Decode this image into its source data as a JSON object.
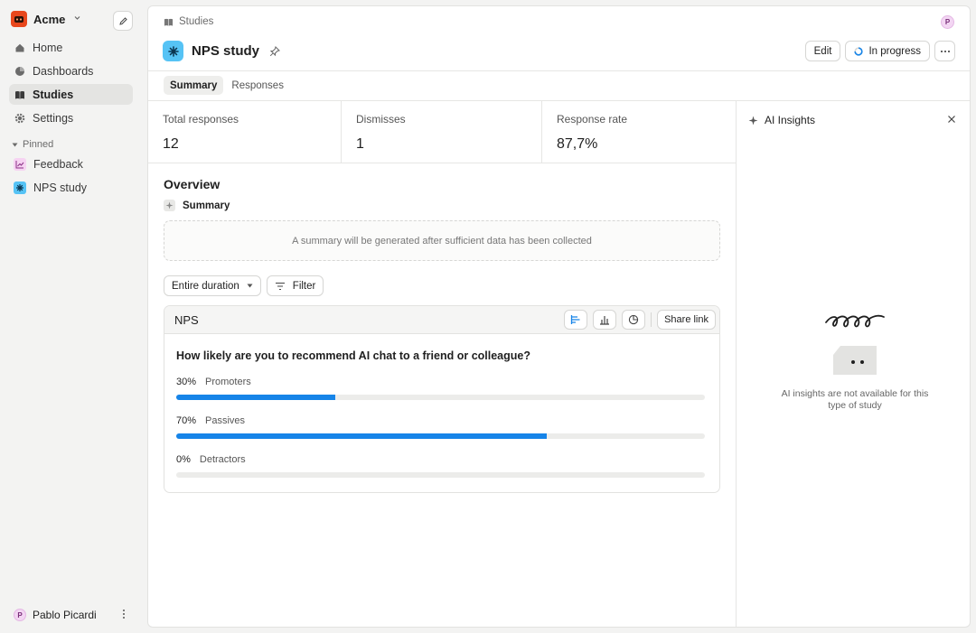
{
  "workspace": {
    "name": "Acme"
  },
  "nav": {
    "items": [
      {
        "label": "Home",
        "icon": "home-icon"
      },
      {
        "label": "Dashboards",
        "icon": "pie-chart-icon"
      },
      {
        "label": "Studies",
        "icon": "book-icon",
        "active": true
      },
      {
        "label": "Settings",
        "icon": "gear-icon"
      }
    ],
    "pinned_label": "Pinned",
    "pinned": [
      {
        "label": "Feedback",
        "icon": "chart-line-icon",
        "color": "#f3c6f0"
      },
      {
        "label": "NPS study",
        "icon": "asterisk-icon",
        "color": "#56c3f5"
      }
    ]
  },
  "user": {
    "name": "Pablo Picardi",
    "initial": "P"
  },
  "header": {
    "breadcrumb": "Studies",
    "title": "NPS study",
    "edit_label": "Edit",
    "status_label": "In progress"
  },
  "tabs": [
    {
      "label": "Summary",
      "active": true
    },
    {
      "label": "Responses",
      "active": false
    }
  ],
  "stats": [
    {
      "label": "Total responses",
      "value": "12"
    },
    {
      "label": "Dismisses",
      "value": "1"
    },
    {
      "label": "Response rate",
      "value": "87,7%"
    }
  ],
  "overview": {
    "title": "Overview",
    "summary_label": "Summary",
    "summary_placeholder": "A summary will be generated after sufficient data has been collected"
  },
  "filters": {
    "duration_label": "Entire duration",
    "filter_label": "Filter"
  },
  "nps_card": {
    "title": "NPS",
    "share_label": "Share link",
    "question": "How likely are you to recommend AI chat to a friend or colleague?",
    "rows": [
      {
        "pct_label": "30%",
        "label": "Promoters",
        "value": 0.3
      },
      {
        "pct_label": "70%",
        "label": "Passives",
        "value": 0.7
      },
      {
        "pct_label": "0%",
        "label": "Detractors",
        "value": 0.0
      }
    ]
  },
  "insights": {
    "title": "AI Insights",
    "message": "AI insights are not available for this type of study"
  },
  "colors": {
    "accent": "#1684e8",
    "study_icon": "#56c3f5",
    "brand": "#e8471c"
  }
}
